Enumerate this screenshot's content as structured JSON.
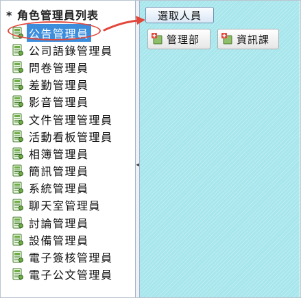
{
  "tree": {
    "title": "* 角色管理員列表",
    "items": [
      {
        "label": "公告管理員",
        "selected": true
      },
      {
        "label": "公司語錄管理員"
      },
      {
        "label": "問卷管理員"
      },
      {
        "label": "差勤管理員"
      },
      {
        "label": "影音管理員"
      },
      {
        "label": "文件管理管理員"
      },
      {
        "label": "活動看板管理員"
      },
      {
        "label": "相簿管理員"
      },
      {
        "label": "簡訊管理員"
      },
      {
        "label": "系統管理員"
      },
      {
        "label": "聊天室管理員"
      },
      {
        "label": "討論管理員"
      },
      {
        "label": "設備管理員"
      },
      {
        "label": "電子簽核管理員"
      },
      {
        "label": "電子公文管理員"
      }
    ]
  },
  "right": {
    "select_button": "選取人員",
    "assigned": [
      {
        "label": "管理部"
      },
      {
        "label": "資訊課"
      }
    ]
  },
  "colors": {
    "selection": "#3c8edc",
    "highlight_ring": "#e2473c",
    "panel_bg": "#a6e6ec"
  },
  "icons": {
    "tree_item": "document-green-icon",
    "assigned_item": "group-add-icon",
    "splitter": "collapse-left-icon"
  }
}
